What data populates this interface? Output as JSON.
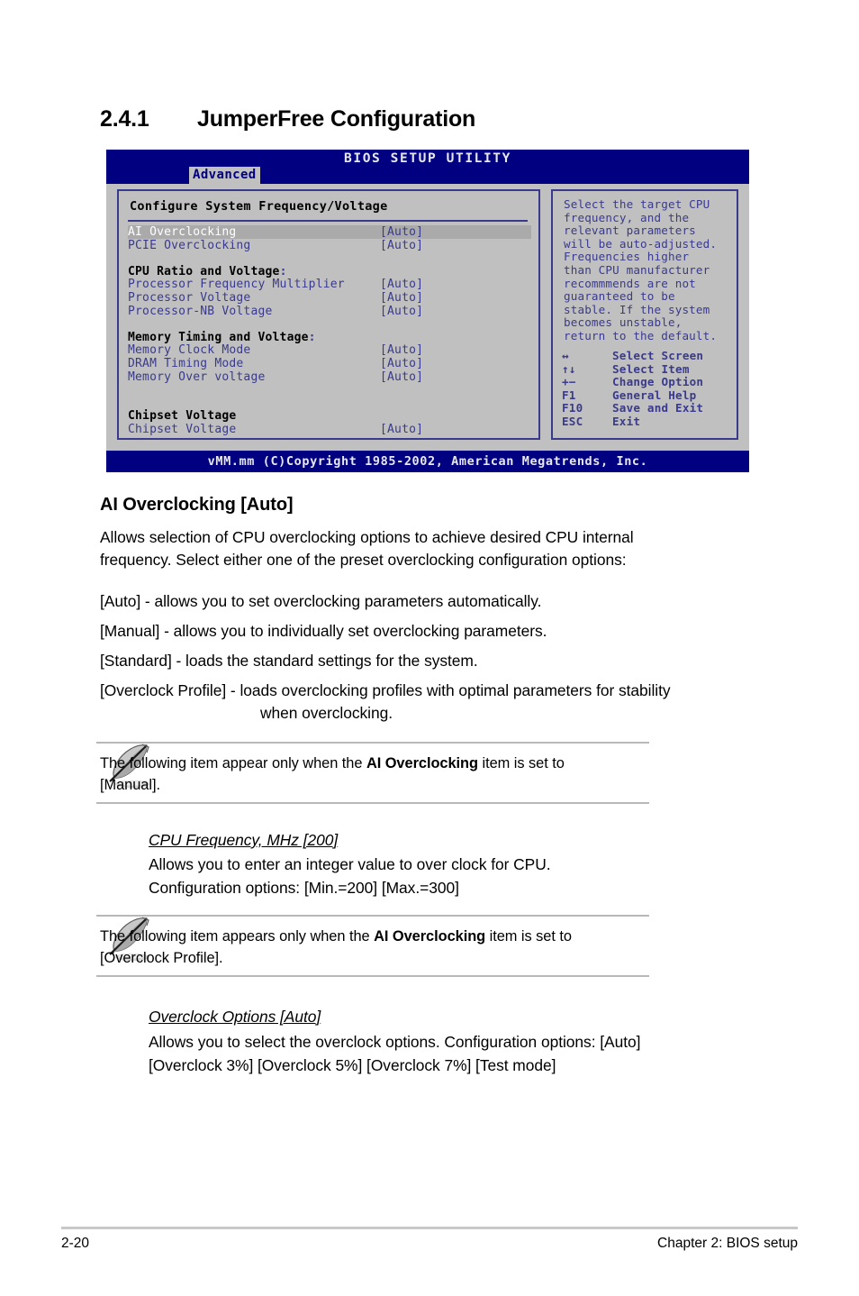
{
  "section": {
    "number": "2.4.1",
    "title": "JumperFree Configuration"
  },
  "bios": {
    "title": "BIOS SETUP UTILITY",
    "active_tab": "Advanced",
    "panel_title": "Configure System Frequency/Voltage",
    "rows": [
      {
        "type": "item",
        "label": "AI Overclocking",
        "value": "[Auto]",
        "selected": true
      },
      {
        "type": "item",
        "label": "PCIE Overclocking",
        "value": "[Auto]",
        "selected": false
      },
      {
        "type": "gap"
      },
      {
        "type": "group",
        "label": "CPU Ratio and Voltage",
        "suffix": ":"
      },
      {
        "type": "item",
        "label": "Processor Frequency Multiplier",
        "value": "[Auto]",
        "selected": false
      },
      {
        "type": "item",
        "label": "Processor Voltage",
        "value": "[Auto]",
        "selected": false
      },
      {
        "type": "item",
        "label": "Processor-NB Voltage",
        "value": "[Auto]",
        "selected": false
      },
      {
        "type": "gap"
      },
      {
        "type": "group",
        "label": "Memory Timing and Voltage",
        "suffix": ":"
      },
      {
        "type": "item",
        "label": "Memory Clock Mode",
        "value": "[Auto]",
        "selected": false
      },
      {
        "type": "item",
        "label": "DRAM Timing Mode",
        "value": "[Auto]",
        "selected": false
      },
      {
        "type": "item",
        "label": "Memory Over voltage",
        "value": "[Auto]",
        "selected": false
      },
      {
        "type": "gap"
      },
      {
        "type": "gap"
      },
      {
        "type": "group",
        "label": "Chipset Voltage",
        "suffix": ""
      },
      {
        "type": "item",
        "label": "Chipset Voltage",
        "value": "[Auto]",
        "selected": false
      }
    ],
    "help_text": "Select the target CPU\nfrequency, and the\nrelevant parameters\nwill be auto-adjusted.\nFrequencies higher\nthan CPU manufacturer\nrecommmends are not\nguaranteed to be\nstable. If the system\nbecomes unstable,\nreturn to the default.",
    "legend": [
      {
        "key": "↔",
        "desc": "Select Screen"
      },
      {
        "key": "↑↓",
        "desc": "Select Item"
      },
      {
        "key": "+−",
        "desc": "Change Option"
      },
      {
        "key": "F1",
        "desc": "General Help"
      },
      {
        "key": "F10",
        "desc": "Save and Exit"
      },
      {
        "key": "ESC",
        "desc": "Exit"
      }
    ],
    "copyright": "vMM.mm (C)Copyright 1985-2002, American Megatrends, Inc.",
    "colors": {
      "chrome_blue": "#000080",
      "panel_gray": "#c0c0c0",
      "text_blue": "#3a3a8c",
      "highlight_gray": "#aaaaaa"
    }
  },
  "content": {
    "heading": "AI Overclocking [Auto]",
    "intro_line1": "Allows selection of CPU overclocking options to achieve desired CPU internal",
    "intro_line2": "frequency. Select either one of the preset overclocking configuration options:",
    "options": [
      "[Auto] - allows you to set overclocking parameters automatically.",
      "[Manual] - allows you to individually set overclocking parameters.",
      "[Standard] - loads the standard settings for the system.",
      "[Overclock Profile] - loads overclocking profiles with optimal parameters for stability"
    ],
    "options_last_cont": "when overclocking.",
    "note1": {
      "before": "The following item appear only when the ",
      "bold": "AI Overclocking",
      "after": " item is set to",
      "line2": "[Manual]."
    },
    "sub1": {
      "title": "CPU Frequency, MHz [200]",
      "line1": "Allows you to enter an integer value to over clock for CPU.",
      "line2": "Configuration options: [Min.=200] [Max.=300]"
    },
    "note2": {
      "before": "The following item appears only when the ",
      "bold": "AI Overclocking",
      "after": " item is set to",
      "line2": "[Overclock Profile]."
    },
    "sub2": {
      "title": "Overclock Options [Auto]",
      "line1": "Allows you to select the overclock options. Configuration options: [Auto]",
      "line2": "[Overclock 3%] [Overclock 5%] [Overclock 7%] [Test mode]"
    }
  },
  "footer": {
    "page_number": "2-20",
    "chapter": "Chapter 2: BIOS setup"
  }
}
